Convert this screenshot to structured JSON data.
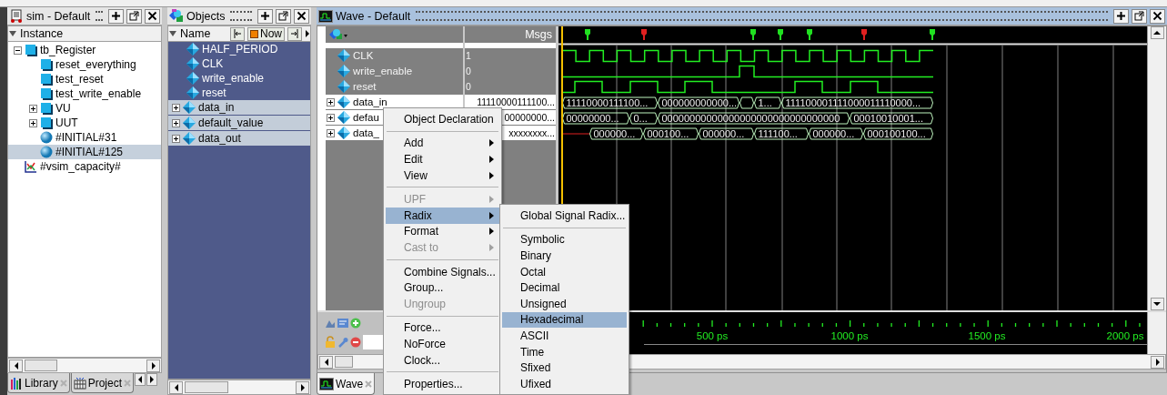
{
  "sim_panel": {
    "title": "sim - Default",
    "column": "Instance",
    "tree": [
      {
        "label": "tb_Register",
        "kind": "instance",
        "expanded": true,
        "selected": false,
        "children": [
          {
            "label": "reset_everything",
            "kind": "instance",
            "selected": false
          },
          {
            "label": "test_reset",
            "kind": "instance",
            "selected": false
          },
          {
            "label": "test_write_enable",
            "kind": "instance",
            "selected": false
          },
          {
            "label": "VU",
            "kind": "instance",
            "expanded": false,
            "selected": false
          },
          {
            "label": "UUT",
            "kind": "instance",
            "expanded": false,
            "selected": false
          },
          {
            "label": "#INITIAL#31",
            "kind": "process",
            "selected": false
          },
          {
            "label": "#INITIAL#125",
            "kind": "process",
            "selected": true
          }
        ]
      },
      {
        "label": "#vsim_capacity#",
        "kind": "capacity",
        "selected": false
      }
    ],
    "tabs": [
      {
        "label": "Library",
        "selected": false
      },
      {
        "label": "Project",
        "selected": false
      }
    ]
  },
  "objects_panel": {
    "title": "Objects",
    "column": "Name",
    "now_label": "Now",
    "items": [
      {
        "label": "HALF_PERIOD",
        "expandable": false,
        "selected": false
      },
      {
        "label": "CLK",
        "expandable": false,
        "selected": false
      },
      {
        "label": "write_enable",
        "expandable": false,
        "selected": false
      },
      {
        "label": "reset",
        "expandable": false,
        "selected": false
      },
      {
        "label": "data_in",
        "expandable": true,
        "selected": true
      },
      {
        "label": "default_value",
        "expandable": true,
        "selected": true
      },
      {
        "label": "data_out",
        "expandable": true,
        "selected": true
      }
    ]
  },
  "wave_panel": {
    "title": "Wave - Default",
    "msgs_label": "Msgs",
    "signals": [
      {
        "name": "CLK",
        "value": "1",
        "kind": "bit",
        "selected": false
      },
      {
        "name": "write_enable",
        "value": "0",
        "kind": "bit",
        "selected": false
      },
      {
        "name": "reset",
        "value": "0",
        "kind": "bit",
        "selected": false
      },
      {
        "name": "data_in",
        "value": "11110000111100...",
        "kind": "bus",
        "selected": true,
        "segments": [
          "11110000111100...",
          "000000000000...",
          "1...",
          "111100001111000011110000..."
        ]
      },
      {
        "name": "defau",
        "value": "00000000...",
        "kind": "bus",
        "selected": true,
        "segments": [
          "00000000...",
          "0...",
          "00000000000000000000000000000000",
          "00010010001..."
        ]
      },
      {
        "name": "data_",
        "value": "xxxxxxxx...",
        "kind": "bus",
        "selected": true,
        "segments": [
          "000000...",
          "000100...",
          "000000...",
          "111100...",
          "000000...",
          "000100100..."
        ]
      }
    ],
    "ruler": [
      "500 ps",
      "1000 ps",
      "1500 ps",
      "2000 ps"
    ],
    "tabs": [
      {
        "label": "Wave",
        "selected": true
      }
    ]
  },
  "context_menu": {
    "items": [
      {
        "label": "Object Declaration",
        "kind": "item",
        "submenu": false,
        "disabled": false,
        "selected": false
      },
      {
        "kind": "separator"
      },
      {
        "label": "Add",
        "kind": "item",
        "submenu": true,
        "disabled": false,
        "selected": false
      },
      {
        "label": "Edit",
        "kind": "item",
        "submenu": true,
        "disabled": false,
        "selected": false
      },
      {
        "label": "View",
        "kind": "item",
        "submenu": true,
        "disabled": false,
        "selected": false
      },
      {
        "kind": "separator"
      },
      {
        "label": "UPF",
        "kind": "item",
        "submenu": true,
        "disabled": true,
        "selected": false
      },
      {
        "label": "Radix",
        "kind": "item",
        "submenu": true,
        "disabled": false,
        "selected": true
      },
      {
        "label": "Format",
        "kind": "item",
        "submenu": true,
        "disabled": false,
        "selected": false
      },
      {
        "label": "Cast to",
        "kind": "item",
        "submenu": true,
        "disabled": true,
        "selected": false
      },
      {
        "kind": "separator"
      },
      {
        "label": "Combine Signals...",
        "kind": "item",
        "submenu": false,
        "disabled": false,
        "selected": false
      },
      {
        "label": "Group...",
        "kind": "item",
        "submenu": false,
        "disabled": false,
        "selected": false
      },
      {
        "label": "Ungroup",
        "kind": "item",
        "submenu": false,
        "disabled": true,
        "selected": false
      },
      {
        "kind": "separator"
      },
      {
        "label": "Force...",
        "kind": "item",
        "submenu": false,
        "disabled": false,
        "selected": false
      },
      {
        "label": "NoForce",
        "kind": "item",
        "submenu": false,
        "disabled": false,
        "selected": false
      },
      {
        "label": "Clock...",
        "kind": "item",
        "submenu": false,
        "disabled": false,
        "selected": false
      },
      {
        "kind": "separator"
      },
      {
        "label": "Properties...",
        "kind": "item",
        "submenu": false,
        "disabled": false,
        "selected": false
      }
    ]
  },
  "radix_submenu": {
    "items": [
      {
        "label": "Global Signal Radix...",
        "kind": "item",
        "selected": false
      },
      {
        "kind": "separator"
      },
      {
        "label": "Symbolic",
        "kind": "item",
        "selected": false
      },
      {
        "label": "Binary",
        "kind": "item",
        "selected": false
      },
      {
        "label": "Octal",
        "kind": "item",
        "selected": false
      },
      {
        "label": "Decimal",
        "kind": "item",
        "selected": false
      },
      {
        "label": "Unsigned",
        "kind": "item",
        "selected": false
      },
      {
        "label": "Hexadecimal",
        "kind": "item",
        "selected": true
      },
      {
        "label": "ASCII",
        "kind": "item",
        "selected": false
      },
      {
        "label": "Time",
        "kind": "item",
        "selected": false
      },
      {
        "label": "Sfixed",
        "kind": "item",
        "selected": false
      },
      {
        "label": "Ufixed",
        "kind": "item",
        "selected": false
      }
    ]
  }
}
